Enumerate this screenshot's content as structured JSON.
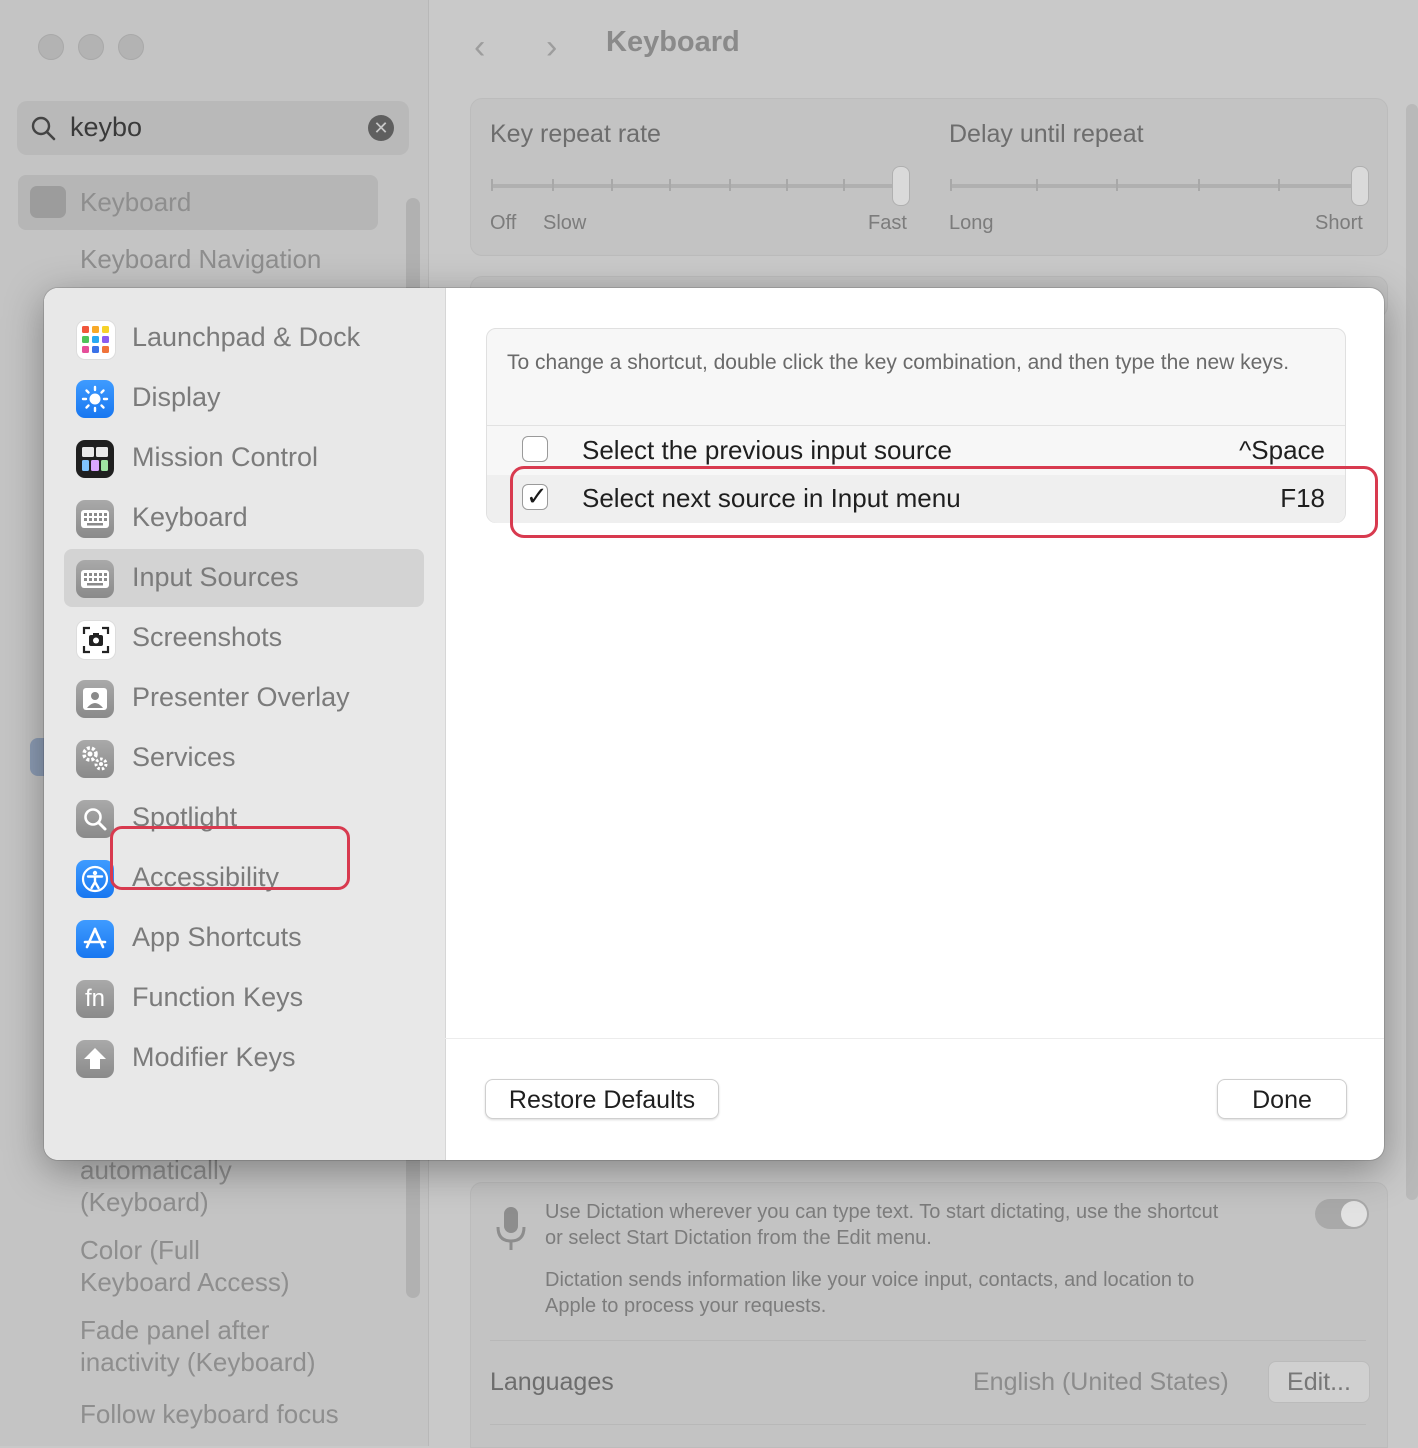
{
  "background": {
    "search": {
      "value": "keybo",
      "clear_glyph": "✕"
    },
    "sidebar": {
      "selected_item": "Keyboard",
      "items": [
        "Keyboard Navigation"
      ],
      "bottom_items": [
        "automatically",
        "(Keyboard)",
        "Color (Full",
        "Keyboard Access)",
        "Fade panel after",
        "inactivity (Keyboard)",
        "Follow keyboard focus"
      ]
    },
    "nav": {
      "back_glyph": "‹",
      "forward_glyph": "›"
    },
    "title": "Keyboard",
    "key_repeat": {
      "label": "Key repeat rate",
      "labels": [
        "Off",
        "Slow",
        "Fast"
      ],
      "value_fraction": 1.0
    },
    "delay_repeat": {
      "label": "Delay until repeat",
      "labels": [
        "Long",
        "Short"
      ],
      "value_fraction": 1.0
    },
    "dictation": {
      "line1": "Use Dictation wherever you can type text. To start dictating, use the shortcut",
      "line2": "or select Start Dictation from the Edit menu.",
      "line3": "Dictation sends information like your voice input, contacts, and location to",
      "line4": "Apple to process your requests."
    },
    "languages": {
      "label": "Languages",
      "value": "English (United States)",
      "edit_label": "Edit..."
    }
  },
  "dialog": {
    "categories": [
      {
        "label": "Launchpad & Dock",
        "icon": "launchpad-icon"
      },
      {
        "label": "Display",
        "icon": "display-icon"
      },
      {
        "label": "Mission Control",
        "icon": "mission-control-icon"
      },
      {
        "label": "Keyboard",
        "icon": "keyboard-icon"
      },
      {
        "label": "Input Sources",
        "icon": "input-sources-icon",
        "selected": true
      },
      {
        "label": "Screenshots",
        "icon": "screenshots-icon"
      },
      {
        "label": "Presenter Overlay",
        "icon": "presenter-overlay-icon"
      },
      {
        "label": "Services",
        "icon": "services-icon"
      },
      {
        "label": "Spotlight",
        "icon": "spotlight-icon"
      },
      {
        "label": "Accessibility",
        "icon": "accessibility-icon"
      },
      {
        "label": "App Shortcuts",
        "icon": "app-shortcuts-icon"
      },
      {
        "label": "Function Keys",
        "icon": "function-keys-icon",
        "glyph": "fn"
      },
      {
        "label": "Modifier Keys",
        "icon": "modifier-keys-icon"
      }
    ],
    "instructions": "To change a shortcut, double click the key combination, and then type the new keys.",
    "shortcuts": [
      {
        "label": "Select the previous input source",
        "key": "^Space",
        "checked": false
      },
      {
        "label": "Select next source in Input menu",
        "key": "F18",
        "checked": true
      }
    ],
    "checkmark": "✓",
    "restore_label": "Restore Defaults",
    "done_label": "Done",
    "colors": {
      "highlight": "#d83a4f",
      "accent": "#1877f0"
    }
  }
}
